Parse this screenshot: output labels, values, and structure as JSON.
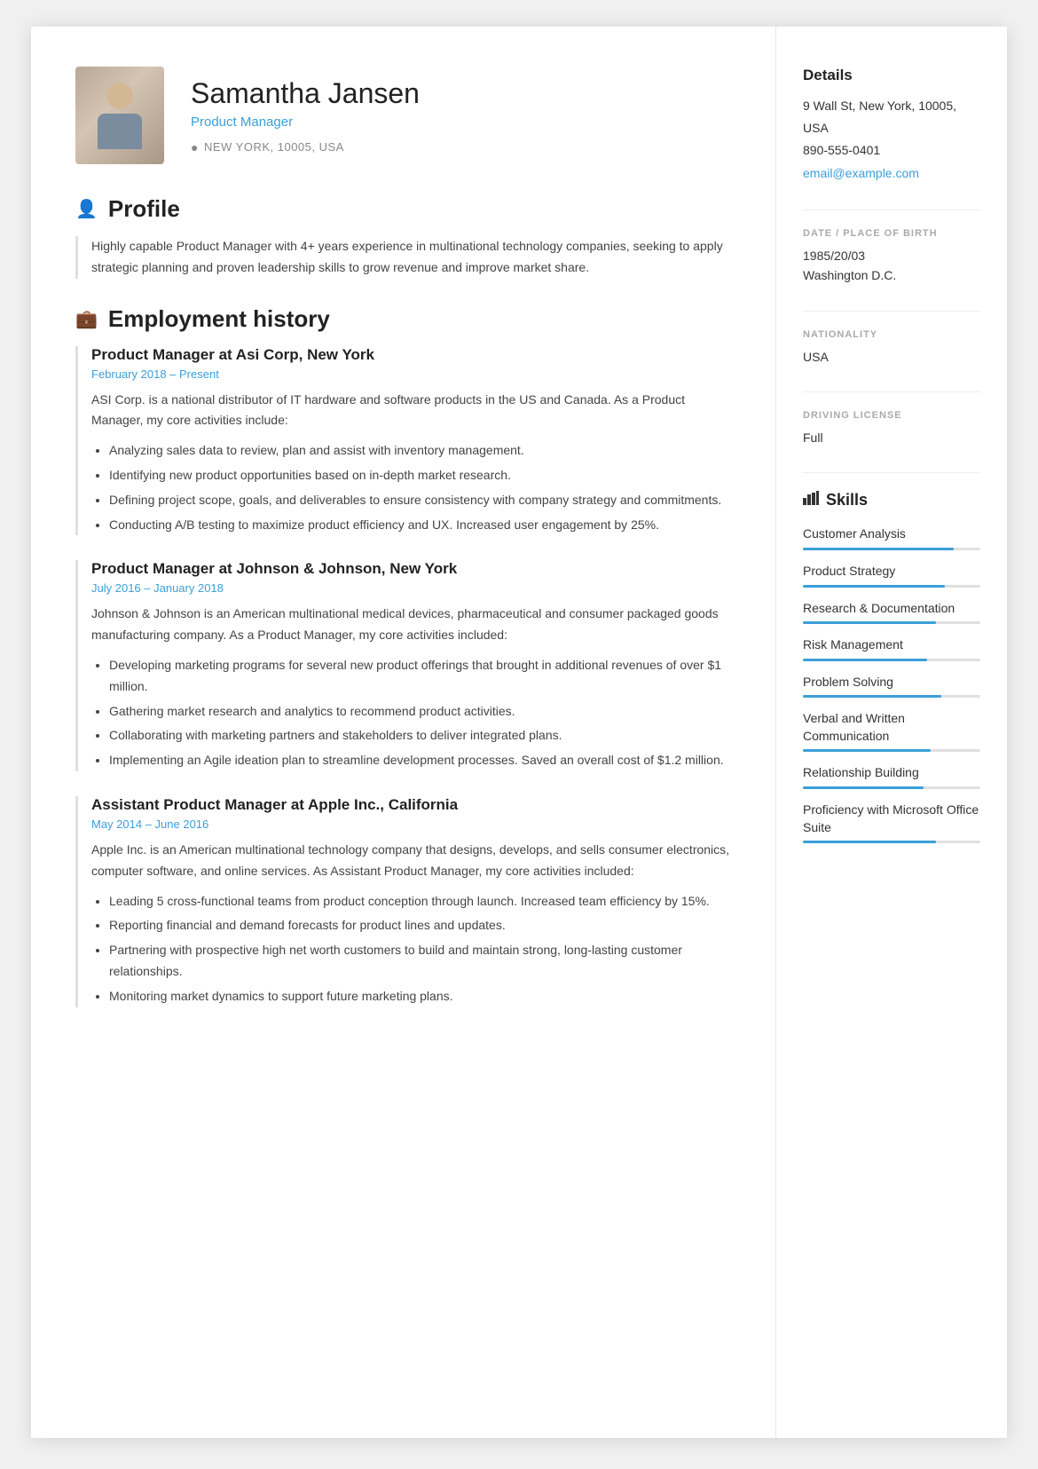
{
  "header": {
    "name": "Samantha Jansen",
    "title": "Product Manager",
    "location": "NEW YORK, 10005, USA"
  },
  "profile": {
    "section_title": "Profile",
    "text": "Highly capable Product Manager with 4+ years experience in multinational technology companies, seeking to apply strategic planning and proven leadership skills to grow revenue and improve market share."
  },
  "employment": {
    "section_title": "Employment history",
    "jobs": [
      {
        "title": "Product Manager at Asi Corp, New York",
        "dates": "February 2018 – Present",
        "description": "ASI Corp. is a national distributor of IT hardware and software products in the US and Canada. As a Product Manager, my core activities include:",
        "bullets": [
          "Analyzing sales data to review, plan and assist with inventory management.",
          "Identifying new product opportunities based on in-depth market research.",
          "Defining project scope, goals, and deliverables to ensure consistency with company strategy and commitments.",
          "Conducting A/B testing to maximize product efficiency and UX. Increased user engagement by 25%."
        ]
      },
      {
        "title": "Product Manager at Johnson & Johnson, New York",
        "dates": "July 2016 – January 2018",
        "description": "Johnson & Johnson is an American multinational medical devices, pharmaceutical and consumer packaged goods manufacturing company. As a Product Manager, my core activities included:",
        "bullets": [
          "Developing marketing programs for several new product offerings that brought in additional revenues of over $1 million.",
          "Gathering market research and analytics to recommend product activities.",
          "Collaborating with marketing partners and stakeholders to deliver integrated plans.",
          "Implementing an Agile ideation plan to streamline development processes. Saved an overall cost of $1.2 million."
        ]
      },
      {
        "title": "Assistant Product Manager at Apple Inc., California",
        "dates": "May 2014 – June 2016",
        "description": "Apple Inc. is an American multinational technology company that designs, develops, and sells consumer electronics, computer software, and online services. As Assistant Product Manager, my core activities included:",
        "bullets": [
          "Leading 5 cross-functional teams from product conception through launch. Increased team efficiency by 15%.",
          "Reporting financial and demand forecasts for product lines and updates.",
          "Partnering with prospective high net worth customers to build and maintain strong, long-lasting customer relationships.",
          "Monitoring market dynamics to support future marketing plans."
        ]
      }
    ]
  },
  "sidebar": {
    "details_title": "Details",
    "address": "9 Wall St, New York, 10005, USA",
    "phone": "890-555-0401",
    "email": "email@example.com",
    "dob_label": "DATE / PLACE OF BIRTH",
    "dob": "1985/20/03",
    "birthplace": "Washington D.C.",
    "nationality_label": "NATIONALITY",
    "nationality": "USA",
    "driving_label": "DRIVING LICENSE",
    "driving": "Full",
    "skills_title": "Skills",
    "skills": [
      {
        "name": "Customer Analysis",
        "level": 85
      },
      {
        "name": "Product Strategy",
        "level": 80
      },
      {
        "name": "Research & Documentation",
        "level": 75
      },
      {
        "name": "Risk Management",
        "level": 70
      },
      {
        "name": "Problem Solving",
        "level": 78
      },
      {
        "name": "Verbal and Written Communication",
        "level": 72
      },
      {
        "name": "Relationship Building",
        "level": 68
      },
      {
        "name": "Proficiency with Microsoft Office Suite",
        "level": 75
      }
    ]
  }
}
